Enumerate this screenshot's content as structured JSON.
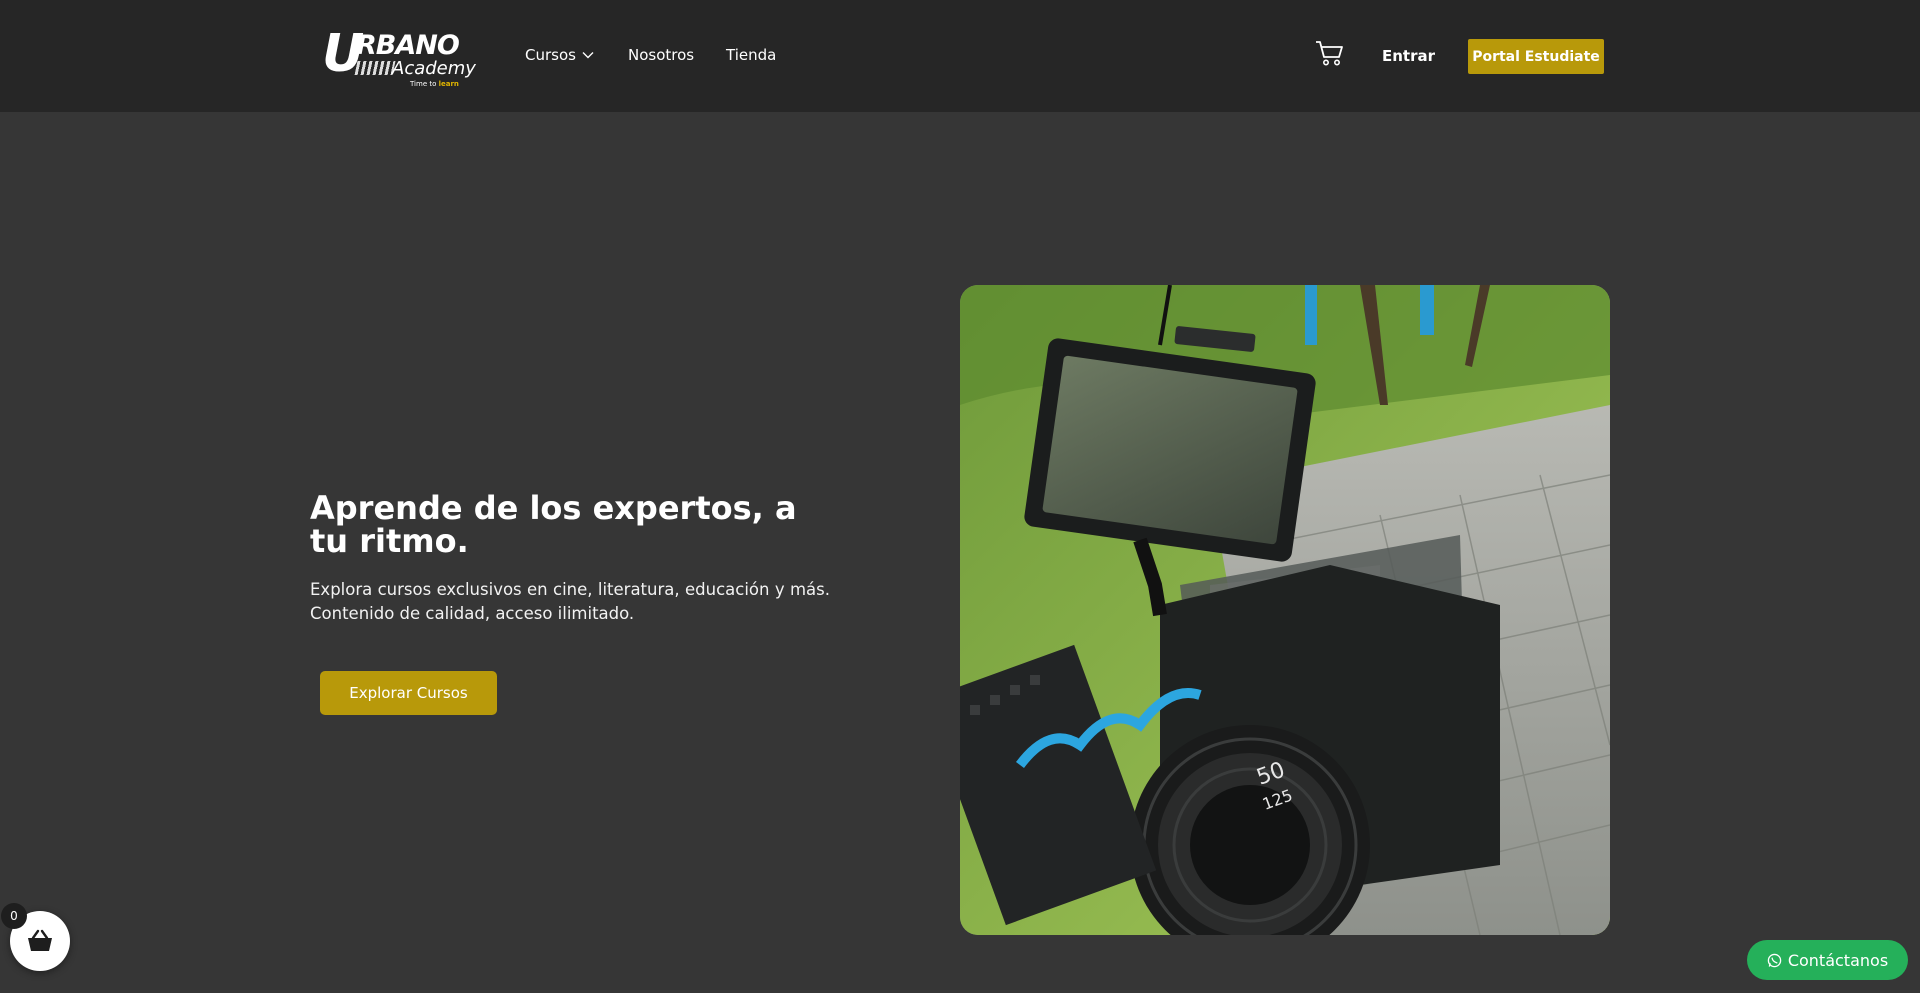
{
  "header": {
    "logo": {
      "brand_big": "U",
      "brand_rest": "RBANO",
      "brand_sub": "Academy",
      "tagline_prefix": "Time to ",
      "tagline_highlight": "learn"
    },
    "nav": {
      "cursos": "Cursos",
      "nosotros": "Nosotros",
      "tienda": "Tienda"
    },
    "entrar": "Entrar",
    "portal": "Portal Estudiate"
  },
  "hero": {
    "title": "Aprende de los expertos, a tu ritmo.",
    "description": "Explora cursos exclusivos en cine, literatura, educación y más. Contenido de calidad, acceso ilimitado.",
    "button": "Explorar Cursos"
  },
  "floating": {
    "basket_count": "0",
    "whatsapp_label": "Contáctanos"
  },
  "colors": {
    "header_bg": "#262626",
    "page_bg": "#363636",
    "accent": "#b8990a",
    "whatsapp": "#25b05a"
  },
  "icons": [
    "chevron-down-icon",
    "cart-icon",
    "basket-icon",
    "whatsapp-icon"
  ]
}
